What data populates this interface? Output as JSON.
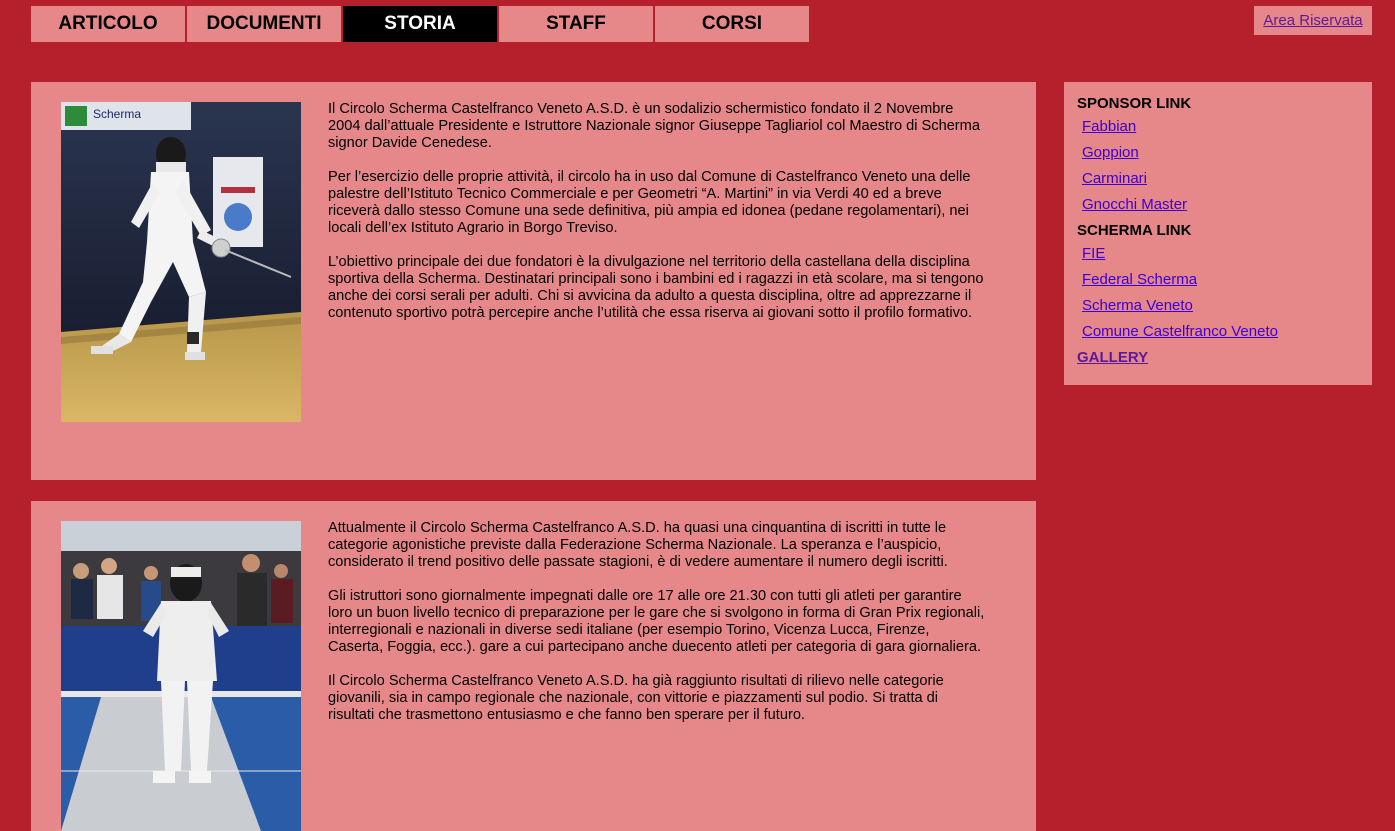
{
  "nav": {
    "tabs": [
      {
        "label": "ARTICOLO"
      },
      {
        "label": "DOCUMENTI"
      },
      {
        "label": "STORIA"
      },
      {
        "label": "STAFF"
      },
      {
        "label": "CORSI"
      }
    ],
    "active_tab": "STORIA",
    "area_riservata": "Area Riservata"
  },
  "section1": {
    "paragraphs": [
      "Il Circolo Scherma Castelfranco Veneto A.S.D. è un sodalizio schermistico fondato il 2 Novembre 2004 dall’attuale Presidente e Istruttore Nazionale signor Giuseppe Tagliariol col Maestro di Scherma signor Davide Cenedese.",
      "Per l’esercizio delle proprie attività, il circolo ha in uso dal Comune di Castelfranco Veneto una delle palestre dell’Istituto Tecnico Commerciale e per Geometri “A. Martini” in via Verdi 40 ed a breve riceverà dallo stesso Comune una sede definitiva, più ampia ed idonea (pedane regolamentari), nei locali dell’ex Istituto Agrario in Borgo Treviso.",
      "L’obiettivo principale dei due fondatori è la divulgazione nel territorio della castellana della disciplina sportiva della Scherma. Destinatari principali sono i bambini ed i ragazzi in età scolare, ma si tengono anche dei corsi serali per adulti. Chi si avvicina da adulto a questa disciplina, oltre ad apprezzarne il contenuto sportivo potrà percepire anche l’utilità che essa riserva ai giovani sotto il profilo formativo."
    ],
    "photo_banner_text": "Scherma"
  },
  "section2": {
    "paragraphs": [
      "Attualmente il Circolo Scherma Castelfranco A.S.D. ha quasi una cinquantina di iscritti in tutte le categorie agonistiche previste dalla Federazione Scherma Nazionale. La speranza e l’auspicio, considerato il trend positivo delle passate stagioni, è di vedere aumentare il numero degli iscritti.",
      "Gli istruttori sono giornalmente impegnati dalle ore 17 alle ore 21.30 con tutti gli atleti per garantire loro un buon livello tecnico di preparazione per le gare che si svolgono in forma di Gran Prix regionali, interregionali e nazionali in diverse sedi italiane (per esempio Torino, Vicenza Lucca, Firenze, Caserta, Foggia, ecc.). gare a cui partecipano anche duecento atleti per categoria di gara giornaliera.",
      "Il Circolo Scherma Castelfranco Veneto A.S.D. ha già raggiunto risultati di rilievo nelle categorie giovanili, sia in campo regionale che nazionale, con vittorie e piazzamenti sul podio. Si tratta di risultati che trasmettono entusiasmo e che fanno ben sperare per il futuro."
    ]
  },
  "sidebar": {
    "sponsor_heading": "SPONSOR LINK",
    "sponsor_links": [
      "Fabbian",
      "Goppion",
      "Carminari",
      "Gnocchi Master"
    ],
    "scherma_heading": "SCHERMA LINK",
    "scherma_links": [
      "FIE",
      "Federal Scherma",
      "Scherma Veneto",
      "Comune Castelfranco Veneto"
    ],
    "gallery": "GALLERY"
  },
  "colors": {
    "background": "#b6202d",
    "panel": "#e68789",
    "active_tab": "#000000",
    "link": "#3b00d6",
    "visited_link": "#5b1a9a"
  }
}
